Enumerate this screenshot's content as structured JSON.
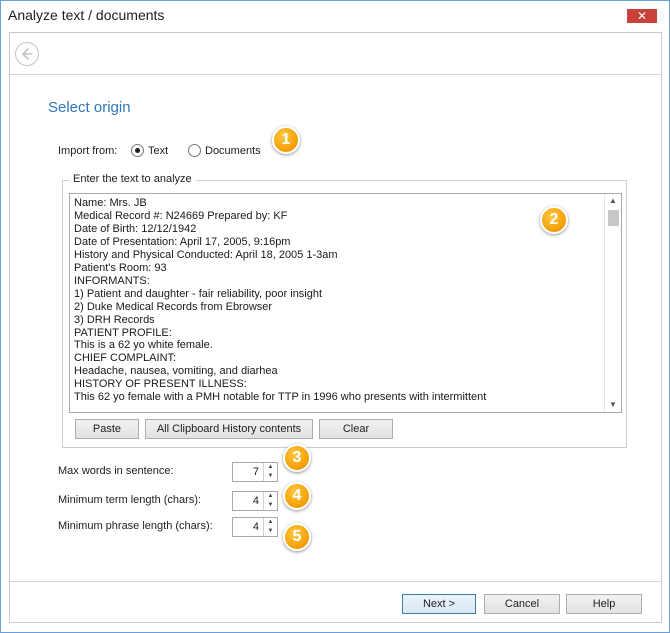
{
  "window": {
    "title": "Analyze text / documents",
    "close_label": "✕"
  },
  "nav": {
    "back_icon": "back-arrow-icon"
  },
  "section_title": "Select origin",
  "import": {
    "label": "Import from:",
    "options": [
      {
        "label": "Text",
        "selected": true
      },
      {
        "label": "Documents",
        "selected": false
      }
    ]
  },
  "text_group": {
    "legend": "Enter the text to analyze",
    "lines": [
      "Name: Mrs. JB",
      "Medical Record #: N24669 Prepared by: KF",
      "Date of Birth: 12/12/1942",
      "Date of Presentation: April 17, 2005, 9:16pm",
      "History and Physical Conducted: April 18, 2005 1-3am",
      "Patient's Room: 93",
      "INFORMANTS:",
      "1) Patient and daughter - fair reliability, poor insight",
      "2) Duke Medical Records from Ebrowser",
      "3) DRH Records",
      "PATIENT PROFILE:",
      "This is a 62 yo white female.",
      "CHIEF COMPLAINT:",
      "Headache, nausea, vomiting, and diarhea",
      "HISTORY OF PRESENT ILLNESS:",
      "This 62 yo female with a PMH notable for TTP in 1996 who presents with intermittent"
    ],
    "buttons": {
      "paste": "Paste",
      "clipboard": "All Clipboard History contents",
      "clear": "Clear"
    }
  },
  "params": [
    {
      "label": "Max words in sentence:",
      "value": "7"
    },
    {
      "label": "Minimum term length (chars):",
      "value": "4"
    },
    {
      "label": "Minimum phrase length (chars):",
      "value": "4"
    }
  ],
  "badges": [
    "1",
    "2",
    "3",
    "4",
    "5"
  ],
  "badge_color": "#f5a30a",
  "accent_color": "#2e78b7",
  "footer": {
    "next": "Next >",
    "cancel": "Cancel",
    "help": "Help"
  }
}
